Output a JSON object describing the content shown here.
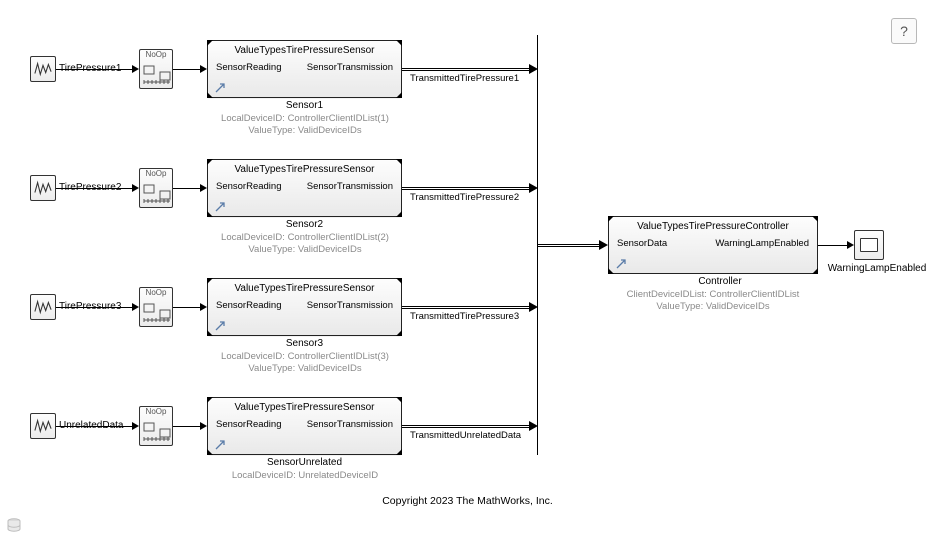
{
  "help_label": "?",
  "copyright": "Copyright 2023 The MathWorks, Inc.",
  "noop_label": "NoOp",
  "lanes": [
    {
      "source_label": "TirePressure1",
      "sensor_header": "ValueTypesTirePressureSensor",
      "in_port": "SensorReading",
      "out_port": "SensorTransmission",
      "block_name": "Sensor1",
      "param1": "LocalDeviceID: ControllerClientIDList(1)",
      "param2": "ValueType: ValidDeviceIDs",
      "signal_label": "TransmittedTirePressure1"
    },
    {
      "source_label": "TirePressure2",
      "sensor_header": "ValueTypesTirePressureSensor",
      "in_port": "SensorReading",
      "out_port": "SensorTransmission",
      "block_name": "Sensor2",
      "param1": "LocalDeviceID: ControllerClientIDList(2)",
      "param2": "ValueType: ValidDeviceIDs",
      "signal_label": "TransmittedTirePressure2"
    },
    {
      "source_label": "TirePressure3",
      "sensor_header": "ValueTypesTirePressureSensor",
      "in_port": "SensorReading",
      "out_port": "SensorTransmission",
      "block_name": "Sensor3",
      "param1": "LocalDeviceID: ControllerClientIDList(3)",
      "param2": "ValueType: ValidDeviceIDs",
      "signal_label": "TransmittedTirePressure3"
    },
    {
      "source_label": "UnrelatedData",
      "sensor_header": "ValueTypesTirePressureSensor",
      "in_port": "SensorReading",
      "out_port": "SensorTransmission",
      "block_name": "SensorUnrelated",
      "param1": "LocalDeviceID: UnrelatedDeviceID",
      "param2": "",
      "signal_label": "TransmittedUnrelatedData"
    }
  ],
  "controller": {
    "header": "ValueTypesTirePressureController",
    "in_port": "SensorData",
    "out_port": "WarningLampEnabled",
    "block_name": "Controller",
    "param1": "ClientDeviceIDList: ControllerClientIDList",
    "param2": "ValueType: ValidDeviceIDs"
  },
  "scope_label": "WarningLampEnabled"
}
